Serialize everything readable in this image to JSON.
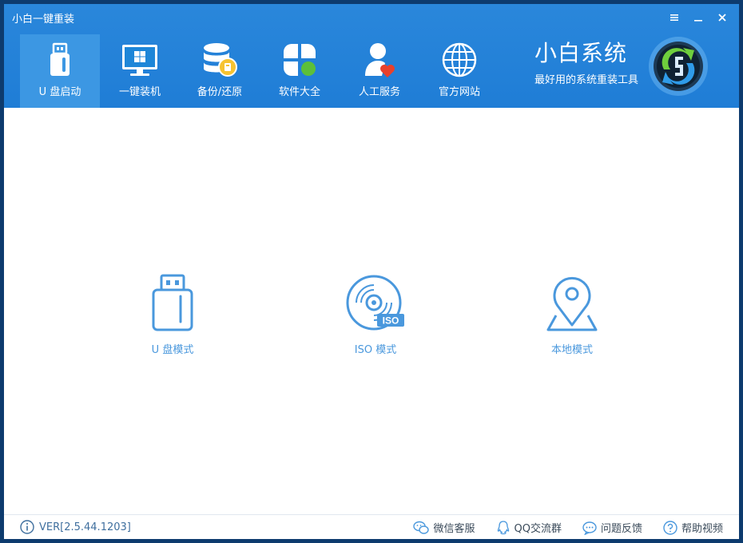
{
  "window": {
    "title": "小白一键重装"
  },
  "nav": [
    {
      "label": "U 盘启动",
      "icon": "usb-drive-icon"
    },
    {
      "label": "一键装机",
      "icon": "monitor-windows-icon"
    },
    {
      "label": "备份/还原",
      "icon": "database-backup-icon"
    },
    {
      "label": "软件大全",
      "icon": "app-grid-icon"
    },
    {
      "label": "人工服务",
      "icon": "person-heart-icon"
    },
    {
      "label": "官方网站",
      "icon": "globe-icon"
    }
  ],
  "brand": {
    "name": "小白系统",
    "slogan": "最好用的系统重装工具"
  },
  "modes": [
    {
      "label": "U 盘模式",
      "icon": "usb-drive-icon"
    },
    {
      "label": "ISO 模式",
      "icon": "iso-disc-icon"
    },
    {
      "label": "本地模式",
      "icon": "map-pin-icon"
    }
  ],
  "iso_badge": "ISO",
  "footer": {
    "version": "VER[2.5.44.1203]",
    "links": [
      {
        "label": "微信客服",
        "icon": "wechat-icon"
      },
      {
        "label": "QQ交流群",
        "icon": "qq-icon"
      },
      {
        "label": "问题反馈",
        "icon": "chat-bubble-icon"
      },
      {
        "label": "帮助视频",
        "icon": "help-circle-icon"
      }
    ]
  },
  "colors": {
    "header": "#1f7dd6",
    "nav_active": "#3c97e3",
    "mode_icon": "#4a98dd"
  }
}
